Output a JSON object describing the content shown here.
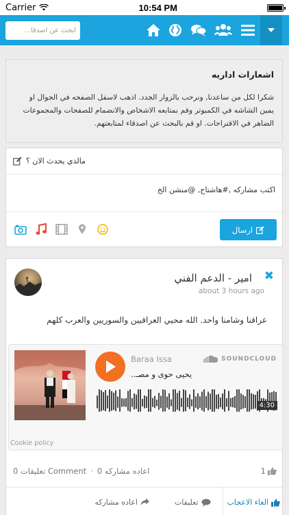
{
  "status": {
    "carrier": "Carrier",
    "time": "10:54 PM",
    "battery_level": 1.0
  },
  "nav": {
    "search_placeholder": "ابحث عن اصدقا...",
    "colors": {
      "bar": "#1ba4dd",
      "dropdown": "#1590c3"
    },
    "icons": [
      "home-icon",
      "globe-icon",
      "chat-icon",
      "users-icon",
      "menu-icon",
      "chevron-down-icon"
    ]
  },
  "notice": {
    "title": "اشعارات اداريه",
    "text": "شكرا لكل من ساعدنا, ونرحب بالزوار الجدد. اذهب لاسفل الصفحه في الجوال او يمين الشاشه في الكمبوتر وقم بمتابعه الاشخاص والانضمام للصفحات والمجموعات الضاهر في الاقتراحات. او قم بالبحث عن اصدقاء لمتابعتهم."
  },
  "composer": {
    "prompt": "مالذي يحدث الان ؟",
    "input_placeholder": "اكتب مشاركه ,#هاشتاج, @منشن الخ",
    "send_label": "ارسال",
    "tools": [
      "camera-icon",
      "music-icon",
      "video-icon",
      "location-icon",
      "emoji-icon"
    ]
  },
  "post": {
    "author": "امير - الدعم الفني",
    "time": "about 3 hours ago",
    "text": "عراقنا وشامنا واحد. الله محيي العراقيين والسوريين والعرب كلهم",
    "soundcloud": {
      "user": "Baraa Issa",
      "track": "يحيى حوى و مصـ..",
      "brand": "SOUNDCLOUD",
      "duration": "4:30",
      "cookie": "Cookie policy"
    },
    "stats": {
      "reshares": "اعاده مشاركه 0",
      "comments": "Comment تعليقات 0",
      "likes": "1"
    },
    "actions": {
      "unlike": "الغاء الاعجاب",
      "comments": "تعليقات",
      "reshare": "اعاده مشاركه"
    }
  }
}
